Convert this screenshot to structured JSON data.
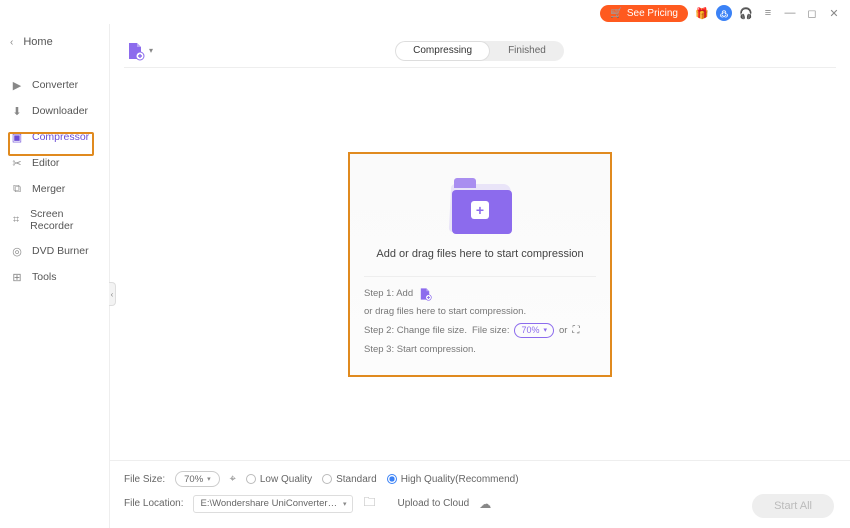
{
  "titlebar": {
    "see_pricing": "See Pricing"
  },
  "sidebar": {
    "home": "Home",
    "items": [
      {
        "label": "Converter"
      },
      {
        "label": "Downloader"
      },
      {
        "label": "Compressor"
      },
      {
        "label": "Editor"
      },
      {
        "label": "Merger"
      },
      {
        "label": "Screen Recorder"
      },
      {
        "label": "DVD Burner"
      },
      {
        "label": "Tools"
      }
    ]
  },
  "tabs": {
    "compressing": "Compressing",
    "finished": "Finished"
  },
  "dropzone": {
    "title": "Add or drag files here to start compression",
    "step1_a": "Step 1: Add",
    "step1_b": "or drag files here to start compression.",
    "step2_a": "Step 2: Change file size.",
    "step2_b": "File size:",
    "step2_size": "70%",
    "step2_or": "or",
    "step3": "Step 3: Start compression."
  },
  "bottom": {
    "filesize_label": "File Size:",
    "filesize_value": "70%",
    "low": "Low Quality",
    "standard": "Standard",
    "high": "High Quality(Recommend)",
    "location_label": "File Location:",
    "location_value": "E:\\Wondershare UniConverter 13",
    "upload_label": "Upload to Cloud",
    "start_all": "Start All"
  }
}
